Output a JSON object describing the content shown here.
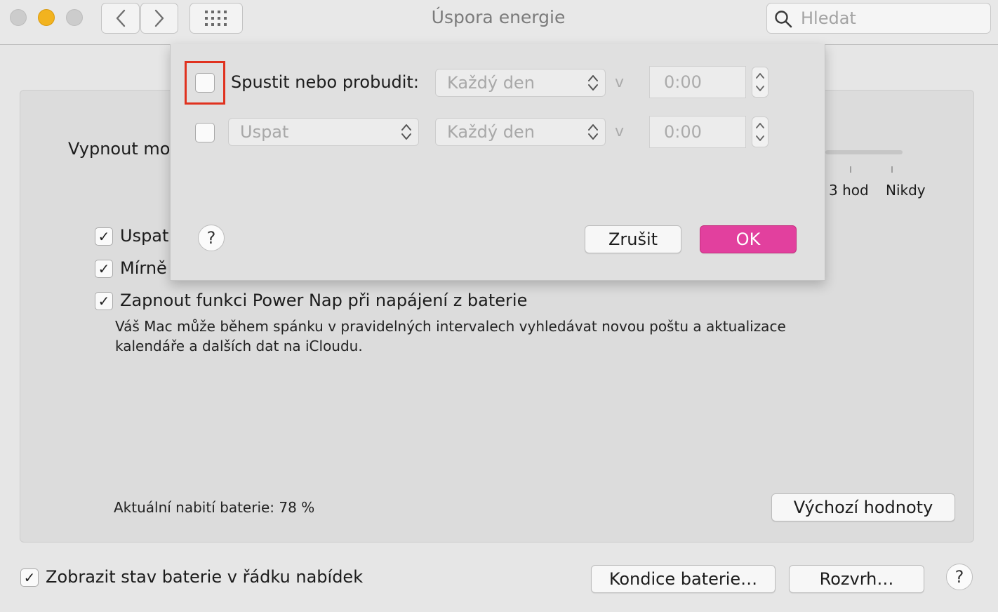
{
  "window": {
    "title": "Úspora energie"
  },
  "search": {
    "placeholder": "Hledat"
  },
  "main": {
    "slider_label": "Vypnout mo",
    "slider_ticks": [
      "3 hod",
      "Nikdy"
    ],
    "options": [
      {
        "label": "Uspat",
        "checked": true
      },
      {
        "label": "Mírně",
        "checked": true
      },
      {
        "label": "Zapnout funkci Power Nap při napájení z baterie",
        "checked": true
      }
    ],
    "power_nap_desc_line1": "Váš Mac může během spánku v pravidelných intervalech vyhledávat novou poštu a aktualizace",
    "power_nap_desc_line2": "kalendáře a dalších dat na iCloudu.",
    "battery_status": "Aktuální nabití baterie: 78 %",
    "defaults_button": "Výchozí hodnoty"
  },
  "footer": {
    "show_status_label": "Zobrazit stav baterie v řádku nabídek",
    "show_status_checked": true,
    "battery_health_button": "Kondice baterie…",
    "schedule_button": "Rozvrh…",
    "help": "?"
  },
  "sheet": {
    "row1": {
      "checked": false,
      "label": "Spustit nebo probudit:",
      "day": "Každý den",
      "at": "v",
      "time": "0:00"
    },
    "row2": {
      "checked": false,
      "action": "Uspat",
      "day": "Každý den",
      "at": "v",
      "time": "0:00"
    },
    "help": "?",
    "cancel": "Zrušit",
    "ok": "OK"
  },
  "colors": {
    "accent": "#e2409e",
    "highlight_box": "#e0321f",
    "close": "#c9c9c9",
    "minimize": "#f0b21f",
    "zoom": "#c9c9c9"
  }
}
